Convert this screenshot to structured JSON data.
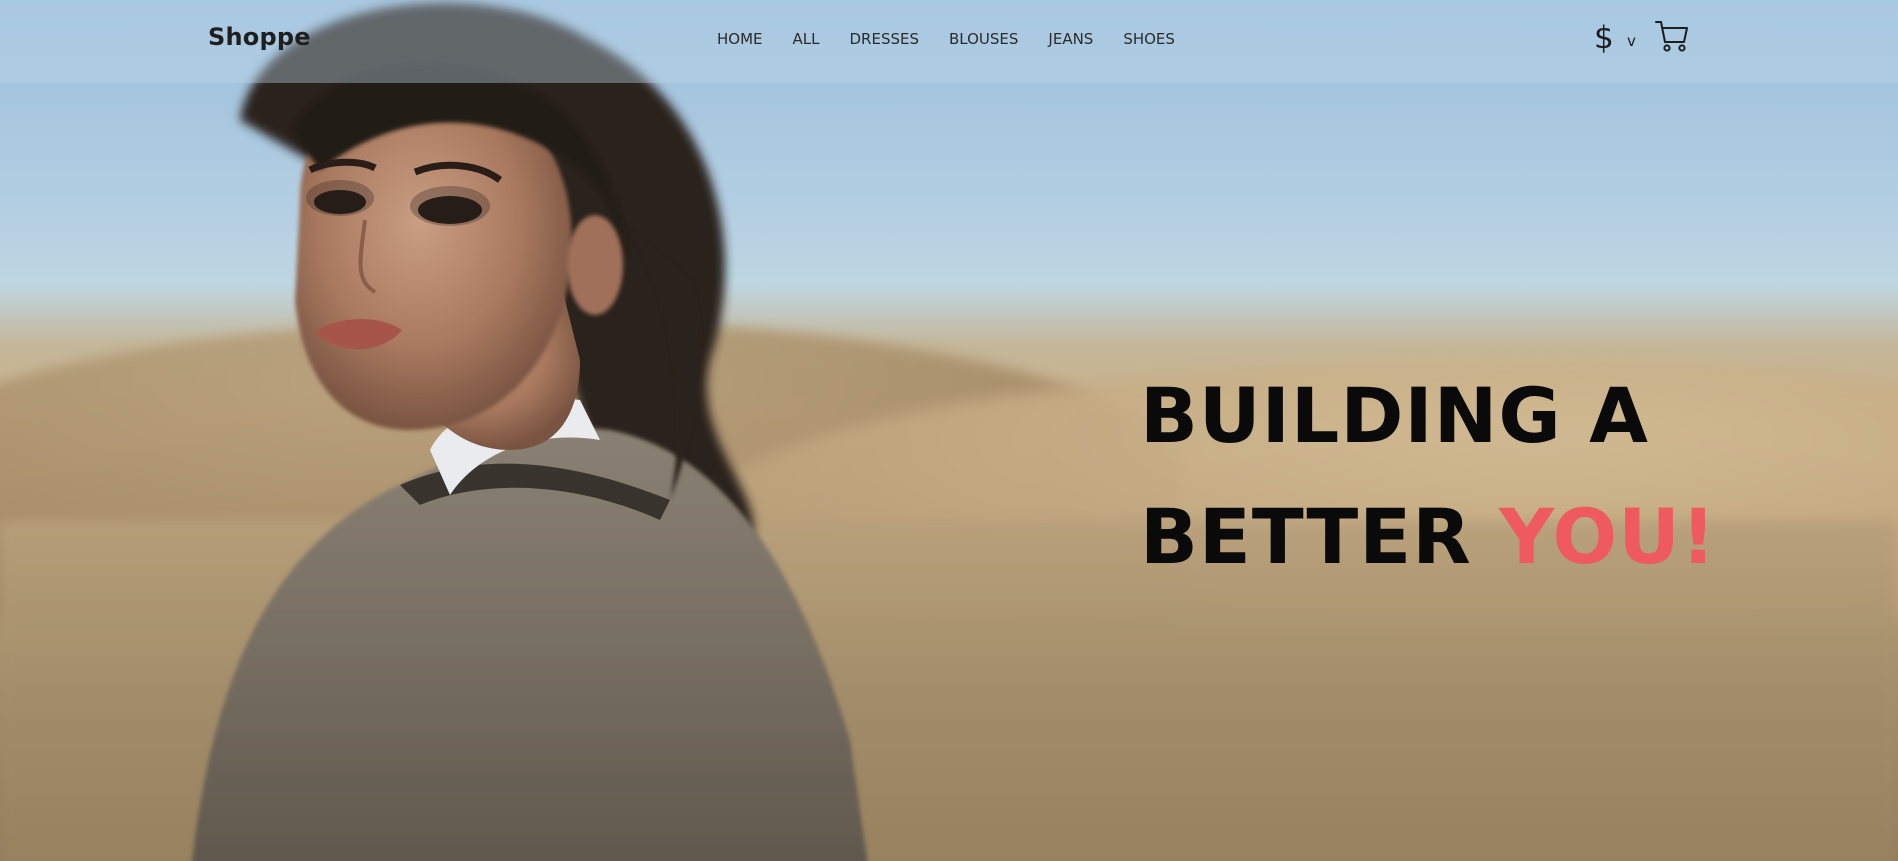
{
  "header": {
    "brand": "Shoppe",
    "nav_items": [
      {
        "label": "HOME"
      },
      {
        "label": "ALL"
      },
      {
        "label": "DRESSES"
      },
      {
        "label": "BLOUSES"
      },
      {
        "label": "JEANS"
      },
      {
        "label": "SHOES"
      }
    ],
    "currency_symbol": "$",
    "currency_caret": "v",
    "cart_icon": "cart-icon"
  },
  "hero": {
    "line1": "BUILDING A",
    "line2_prefix": "BETTER ",
    "line2_accent": "YOU!",
    "accent_color": "#ee5a5e"
  }
}
